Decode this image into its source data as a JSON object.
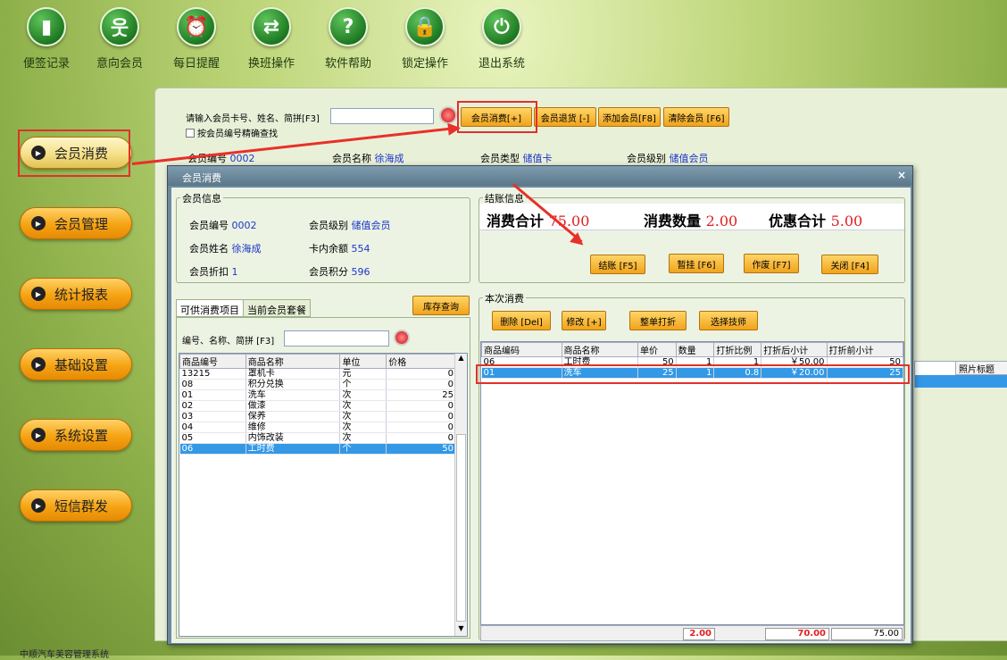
{
  "toolbar": {
    "items": [
      {
        "label": "便签记录",
        "icon": "note-icon",
        "glyph": "▮"
      },
      {
        "label": "意向会员",
        "icon": "person-icon",
        "glyph": "웃"
      },
      {
        "label": "每日提醒",
        "icon": "alarm-clock-icon",
        "glyph": "⏰"
      },
      {
        "label": "换班操作",
        "icon": "switch-arrows-icon",
        "glyph": "⇄"
      },
      {
        "label": "软件帮助",
        "icon": "help-icon",
        "glyph": "?"
      },
      {
        "label": "锁定操作",
        "icon": "lock-icon",
        "glyph": "🔒"
      },
      {
        "label": "退出系统",
        "icon": "power-icon",
        "glyph": "⏻"
      }
    ]
  },
  "sidebar": {
    "items": [
      {
        "label": "会员消费"
      },
      {
        "label": "会员管理"
      },
      {
        "label": "统计报表"
      },
      {
        "label": "基础设置"
      },
      {
        "label": "系统设置"
      },
      {
        "label": "短信群发"
      }
    ]
  },
  "search": {
    "prompt": "请输入会员卡号、姓名、简拼[F3]",
    "value": "",
    "exact_label": "按会员编号精确查找",
    "buttons": [
      "会员消费[+]",
      "会员退货 [-]",
      "添加会员[F8]",
      "清除会员 [F6]"
    ]
  },
  "member_bar": {
    "no_label": "会员编号",
    "no_value": "0002",
    "name_label": "会员名称",
    "name_value": "徐海成",
    "type_label": "会员类型",
    "type_value": "储值卡",
    "level_label": "会员级别",
    "level_value": "储值会员"
  },
  "bg_grid": {
    "photo_header": "照片标题"
  },
  "modal": {
    "title": "会员消费",
    "close": "×",
    "member_info": {
      "title": "会员信息",
      "no_label": "会员编号",
      "no_value": "0002",
      "level_label": "会员级别",
      "level_value": "储值会员",
      "name_label": "会员姓名",
      "name_value": "徐海成",
      "balance_label": "卡内余额",
      "balance_value": "554",
      "discount_label": "会员折扣",
      "discount_value": "1",
      "points_label": "会员积分",
      "points_value": "596"
    },
    "checkout": {
      "title": "结账信息",
      "total_label": "消费合计",
      "total_value": "75.00",
      "qty_label": "消费数量",
      "qty_value": "2.00",
      "discount_label": "优惠合计",
      "discount_value": "5.00",
      "buttons": [
        "结账 [F5]",
        "暂挂 [F6]",
        "作废 [F7]",
        "关闭 [F4]"
      ]
    },
    "tabs": [
      "可供消费项目",
      "当前会员套餐"
    ],
    "stock_button": "库存查询",
    "item_search_label": "编号、名称、简拼 [F3]",
    "item_search_value": "",
    "items_table": {
      "headers": [
        "商品编号",
        "商品名称",
        "单位",
        "价格"
      ],
      "rows": [
        [
          "13215",
          "罩机卡",
          "元",
          "0"
        ],
        [
          "08",
          "积分兑换",
          "个",
          "0"
        ],
        [
          "01",
          "洗车",
          "次",
          "25"
        ],
        [
          "02",
          "做漆",
          "次",
          "0"
        ],
        [
          "03",
          "保养",
          "次",
          "0"
        ],
        [
          "04",
          "维修",
          "次",
          "0"
        ],
        [
          "05",
          "内饰改装",
          "次",
          "0"
        ],
        [
          "06",
          "工时费",
          "个",
          "50"
        ]
      ],
      "selected_index": 7
    },
    "current": {
      "title": "本次消费",
      "buttons": [
        "删除 [Del]",
        "修改 [+]",
        "整单打折",
        "选择技师"
      ],
      "headers": [
        "商品编码",
        "商品名称",
        "单价",
        "数量",
        "打折比例",
        "打折后小计",
        "打折前小计"
      ],
      "rows": [
        [
          "06",
          "工时费",
          "50",
          "1",
          "1",
          "￥50.00",
          "50"
        ],
        [
          "01",
          "洗车",
          "25",
          "1",
          "0.8",
          "￥20.00",
          "25"
        ]
      ],
      "selected_index": 1,
      "summary": {
        "qty": "2.00",
        "after": "70.00",
        "before": "75.00"
      }
    }
  },
  "status_bar": "中顺汽车美容管理系统"
}
